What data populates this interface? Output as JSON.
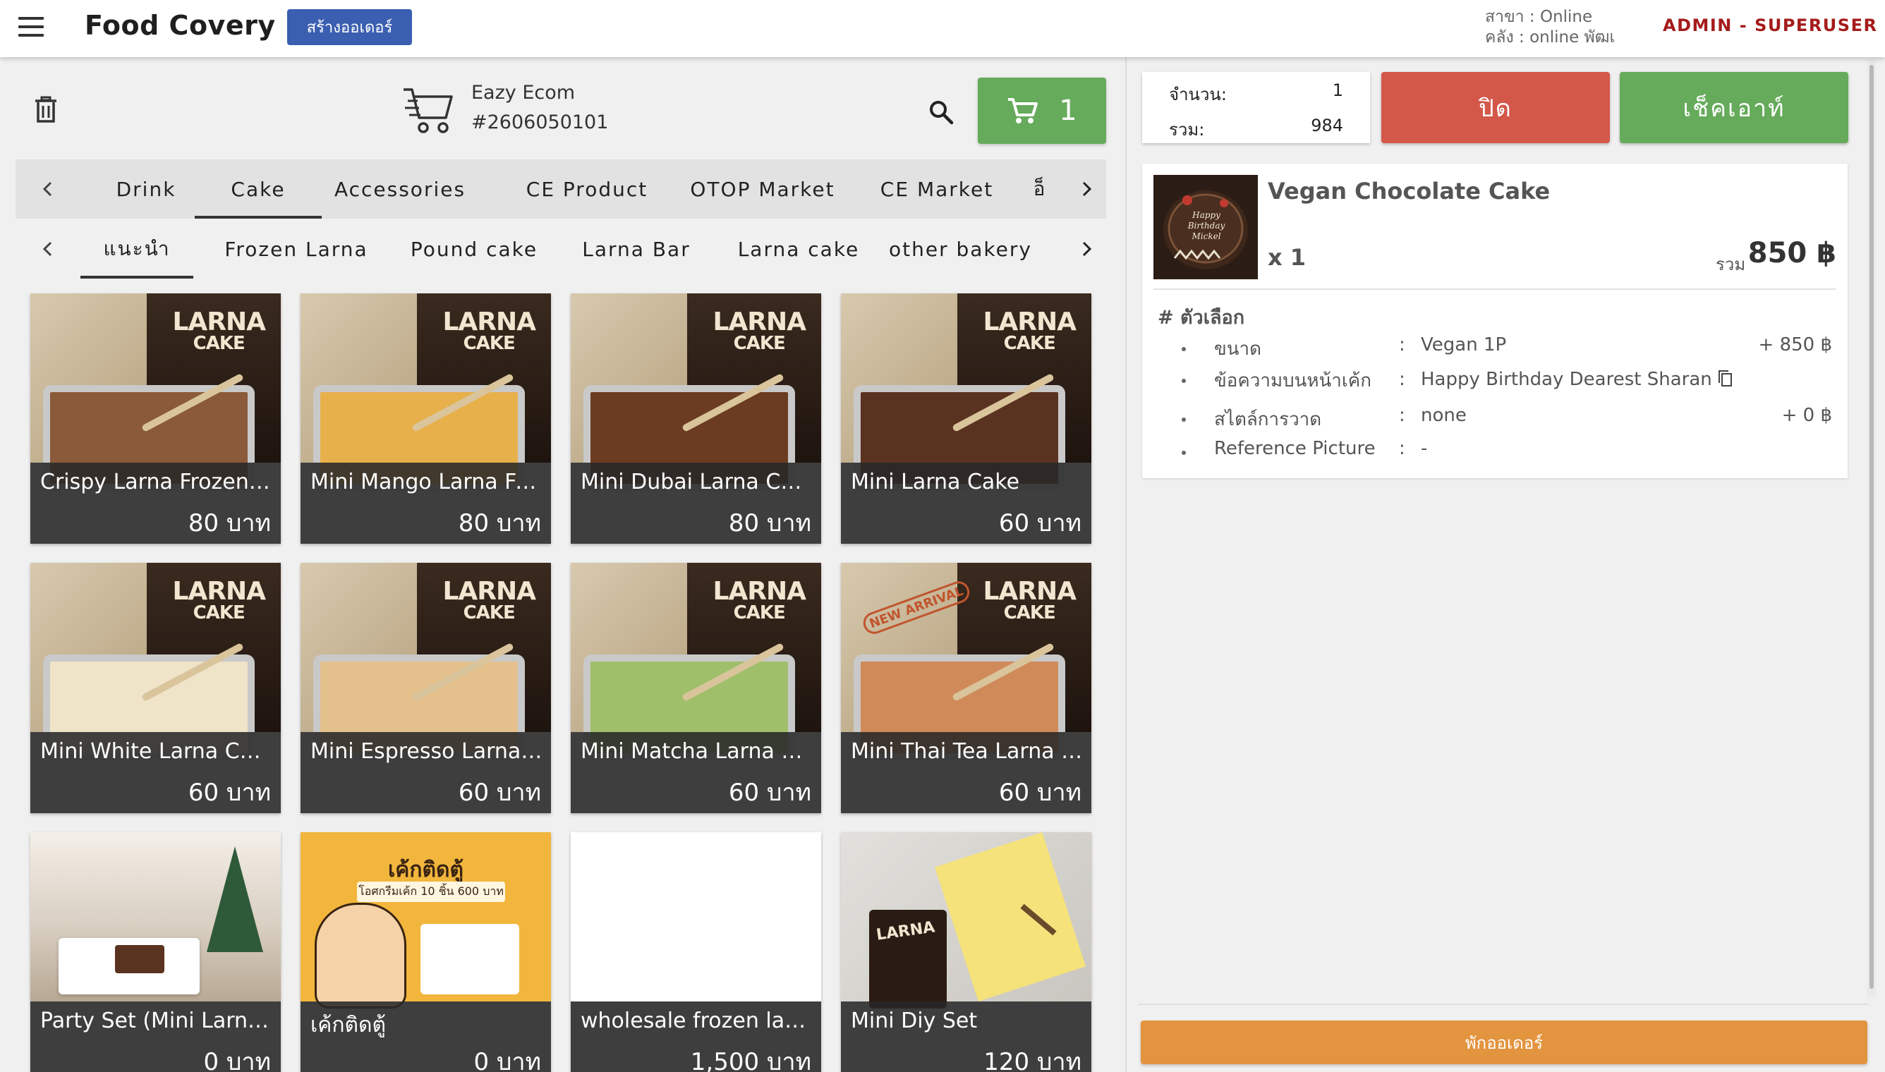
{
  "header": {
    "brand": "Food Covery",
    "create_order_label": "สร้างออเดอร์",
    "branch": "สาขา : Online",
    "warehouse": "คลัง : online พัฒเ",
    "user": "ADMIN - SUPERUSER"
  },
  "store": {
    "name": "Eazy Ecom",
    "order_no": "#2606050101",
    "cart_count": "1"
  },
  "category_tabs": {
    "items": [
      "Drink",
      "Cake",
      "Accessories",
      "CE Product",
      "OTOP Market",
      "CE Market",
      "อ็"
    ],
    "active": "Cake"
  },
  "sub_tabs": {
    "items": [
      "แนะนำ",
      "Frozen Larna",
      "Pound cake",
      "Larna Bar",
      "Larna cake",
      "other bakery"
    ],
    "active": "แนะนำ"
  },
  "products": [
    {
      "name": "Crispy Larna Frozen ...",
      "price": "80 บาท",
      "art": "larna",
      "fill": "#8a5a3a"
    },
    {
      "name": "Mini Mango Larna Fro...",
      "price": "80 บาท",
      "art": "larna",
      "fill": "#e8b04a"
    },
    {
      "name": "Mini Dubai Larna Cak...",
      "price": "80 บาท",
      "art": "larna",
      "fill": "#6b3b22"
    },
    {
      "name": "Mini Larna Cake",
      "price": "60 บาท",
      "art": "larna",
      "fill": "#5a3220"
    },
    {
      "name": "Mini White Larna Cake",
      "price": "60 บาท",
      "art": "larna",
      "fill": "#efe3c8"
    },
    {
      "name": "Mini Espresso Larna ...",
      "price": "60 บาท",
      "art": "larna",
      "fill": "#e4c08c"
    },
    {
      "name": "Mini Matcha Larna Ca...",
      "price": "60 บาท",
      "art": "larna",
      "fill": "#9fbf6a"
    },
    {
      "name": "Mini Thai Tea Larna C...",
      "price": "60 บาท",
      "art": "larna",
      "fill": "#d08a5a"
    },
    {
      "name": "Party Set (Mini Larna ...",
      "price": "0 บาท",
      "art": "party",
      "fill": "#d9cfc2"
    },
    {
      "name": "เค้กติดตู้",
      "price": "0 บาท",
      "art": "poster",
      "fill": "#f2b63c"
    },
    {
      "name": "wholesale frozen larn...",
      "price": "1,500 บาท",
      "art": "blank",
      "fill": "#ffffff"
    },
    {
      "name": "Mini Diy Set",
      "price": "120 บาท",
      "art": "diy",
      "fill": "#c9c6c0"
    }
  ],
  "product_art_text": {
    "box_line1": "LARNA",
    "box_line2": "CAKE",
    "poster_title": "เค้กติดตู้",
    "poster_sub": "โอศกรีมเค้ก 10 ชิ้น 600 บาท",
    "new_arrival": "NEW ARRIVAL"
  },
  "summary": {
    "qty_label": "จำนวน:",
    "qty_value": "1",
    "total_label": "รวม:",
    "total_value": "984"
  },
  "actions": {
    "close_label": "ปิด",
    "checkout_label": "เช็คเอาท์",
    "hold_label": "พักออเดอร์"
  },
  "cart_item": {
    "name": "Vegan Chocolate Cake",
    "qty": "x 1",
    "total_label": "รวม",
    "total": "850 ฿",
    "thumb_text": "Happy Birthday Mickel",
    "options_title": "# ตัวเลือก",
    "options": [
      {
        "name": "ขนาด",
        "value": "Vegan 1P",
        "price": "+ 850 ฿"
      },
      {
        "name": "ข้อความบนหน้าเค้ก",
        "value": "Happy Birthday Dearest Sharan",
        "price": ""
      },
      {
        "name": "สไตล์การวาด",
        "value": "none",
        "price": "+ 0 ฿"
      },
      {
        "name": "Reference Picture",
        "value": "-",
        "price": ""
      }
    ]
  },
  "colors": {
    "accent_blue": "#3b5fb0",
    "green": "#66ab5b",
    "red": "#d4584a",
    "orange": "#e3943f",
    "admin_red": "#a51b1b"
  }
}
